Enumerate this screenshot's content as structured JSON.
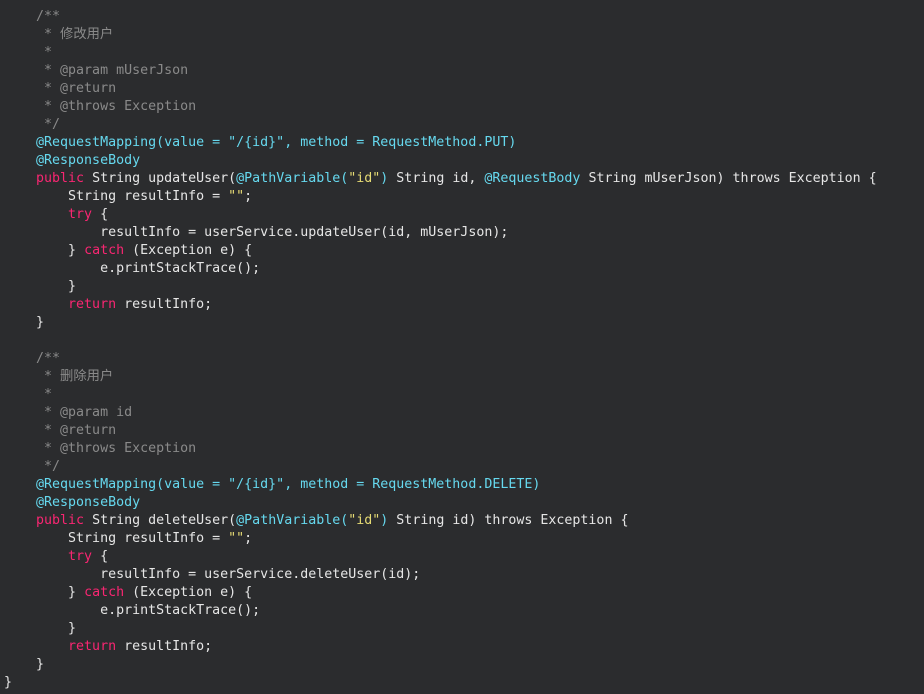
{
  "colors": {
    "background": "#2b2c2e",
    "comment": "#8a8a8a",
    "annotation": "#66d9ef",
    "keyword": "#f92672",
    "string": "#e6db74",
    "text": "#e6e6e6"
  },
  "code_lines": [
    [
      {
        "t": "comment",
        "v": "    /**"
      }
    ],
    [
      {
        "t": "comment",
        "v": "     * 修改用户"
      }
    ],
    [
      {
        "t": "comment",
        "v": "     *"
      }
    ],
    [
      {
        "t": "comment",
        "v": "     * @param mUserJson"
      }
    ],
    [
      {
        "t": "comment",
        "v": "     * @return"
      }
    ],
    [
      {
        "t": "comment",
        "v": "     * @throws Exception"
      }
    ],
    [
      {
        "t": "comment",
        "v": "     */"
      }
    ],
    [
      {
        "t": "annotation",
        "v": "    @RequestMapping(value = \"/{id}\", method = RequestMethod.PUT)"
      }
    ],
    [
      {
        "t": "annotation",
        "v": "    @ResponseBody"
      }
    ],
    [
      {
        "t": "keyword",
        "v": "    public "
      },
      {
        "t": "default",
        "v": "String updateUser("
      },
      {
        "t": "annotation",
        "v": "@PathVariable("
      },
      {
        "t": "string",
        "v": "\"id\""
      },
      {
        "t": "annotation",
        "v": ")"
      },
      {
        "t": "default",
        "v": " String id, "
      },
      {
        "t": "annotation",
        "v": "@RequestBody"
      },
      {
        "t": "default",
        "v": " String mUserJson) throws Exception {"
      }
    ],
    [
      {
        "t": "default",
        "v": "        String resultInfo = "
      },
      {
        "t": "string",
        "v": "\"\""
      },
      {
        "t": "default",
        "v": ";"
      }
    ],
    [
      {
        "t": "keyword",
        "v": "        try "
      },
      {
        "t": "default",
        "v": "{"
      }
    ],
    [
      {
        "t": "default",
        "v": "            resultInfo = userService.updateUser(id, mUserJson);"
      }
    ],
    [
      {
        "t": "default",
        "v": "        } "
      },
      {
        "t": "keyword",
        "v": "catch "
      },
      {
        "t": "default",
        "v": "(Exception e) {"
      }
    ],
    [
      {
        "t": "default",
        "v": "            e.printStackTrace();"
      }
    ],
    [
      {
        "t": "default",
        "v": "        }"
      }
    ],
    [
      {
        "t": "keyword",
        "v": "        return "
      },
      {
        "t": "default",
        "v": "resultInfo;"
      }
    ],
    [
      {
        "t": "default",
        "v": "    }"
      }
    ],
    [],
    [
      {
        "t": "comment",
        "v": "    /**"
      }
    ],
    [
      {
        "t": "comment",
        "v": "     * 删除用户"
      }
    ],
    [
      {
        "t": "comment",
        "v": "     *"
      }
    ],
    [
      {
        "t": "comment",
        "v": "     * @param id"
      }
    ],
    [
      {
        "t": "comment",
        "v": "     * @return"
      }
    ],
    [
      {
        "t": "comment",
        "v": "     * @throws Exception"
      }
    ],
    [
      {
        "t": "comment",
        "v": "     */"
      }
    ],
    [
      {
        "t": "annotation",
        "v": "    @RequestMapping(value = \"/{id}\", method = RequestMethod.DELETE)"
      }
    ],
    [
      {
        "t": "annotation",
        "v": "    @ResponseBody"
      }
    ],
    [
      {
        "t": "keyword",
        "v": "    public "
      },
      {
        "t": "default",
        "v": "String deleteUser("
      },
      {
        "t": "annotation",
        "v": "@PathVariable("
      },
      {
        "t": "string",
        "v": "\"id\""
      },
      {
        "t": "annotation",
        "v": ")"
      },
      {
        "t": "default",
        "v": " String id) throws Exception {"
      }
    ],
    [
      {
        "t": "default",
        "v": "        String resultInfo = "
      },
      {
        "t": "string",
        "v": "\"\""
      },
      {
        "t": "default",
        "v": ";"
      }
    ],
    [
      {
        "t": "keyword",
        "v": "        try "
      },
      {
        "t": "default",
        "v": "{"
      }
    ],
    [
      {
        "t": "default",
        "v": "            resultInfo = userService.deleteUser(id);"
      }
    ],
    [
      {
        "t": "default",
        "v": "        } "
      },
      {
        "t": "keyword",
        "v": "catch "
      },
      {
        "t": "default",
        "v": "(Exception e) {"
      }
    ],
    [
      {
        "t": "default",
        "v": "            e.printStackTrace();"
      }
    ],
    [
      {
        "t": "default",
        "v": "        }"
      }
    ],
    [
      {
        "t": "keyword",
        "v": "        return "
      },
      {
        "t": "default",
        "v": "resultInfo;"
      }
    ],
    [
      {
        "t": "default",
        "v": "    }"
      }
    ],
    [
      {
        "t": "default",
        "v": "}"
      }
    ]
  ]
}
